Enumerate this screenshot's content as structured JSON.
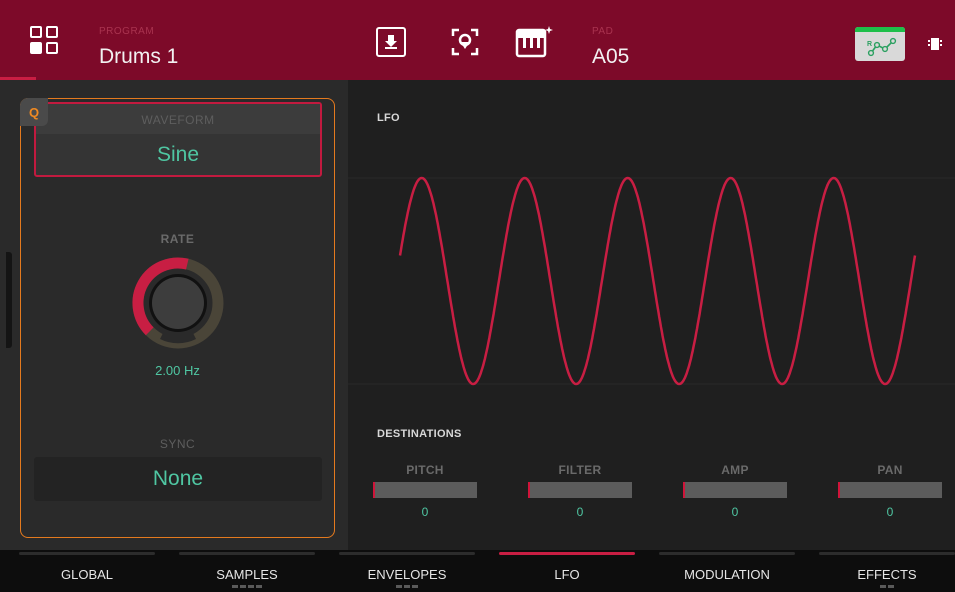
{
  "header": {
    "program_label": "PROGRAM",
    "program_value": "Drums 1",
    "pad_label": "PAD",
    "pad_value": "A05",
    "icons": [
      "grid-menu-icon",
      "download-icon",
      "locate-icon",
      "pad-keyboard-icon",
      "automation-icon",
      "chip-icon"
    ],
    "automation_status_color": "#1fbf4a"
  },
  "left": {
    "q_badge": "Q",
    "waveform": {
      "label": "WAVEFORM",
      "value": "Sine"
    },
    "rate": {
      "label": "RATE",
      "value": "2.00 Hz",
      "knob_level": 0.55
    },
    "sync": {
      "label": "SYNC",
      "value": "None"
    }
  },
  "lfo": {
    "title": "LFO",
    "wave_type": "sine",
    "cycles_shown": 5,
    "wave_color": "#c81e43"
  },
  "destinations": {
    "title": "DESTINATIONS",
    "items": [
      {
        "name": "PITCH",
        "value": "0"
      },
      {
        "name": "FILTER",
        "value": "0"
      },
      {
        "name": "AMP",
        "value": "0"
      },
      {
        "name": "PAN",
        "value": "0"
      }
    ]
  },
  "tabs": [
    {
      "label": "GLOBAL",
      "active": false,
      "pages": 0
    },
    {
      "label": "SAMPLES",
      "active": false,
      "pages": 4
    },
    {
      "label": "ENVELOPES",
      "active": false,
      "pages": 3
    },
    {
      "label": "LFO",
      "active": true,
      "pages": 0
    },
    {
      "label": "MODULATION",
      "active": false,
      "pages": 0
    },
    {
      "label": "EFFECTS",
      "active": false,
      "pages": 2
    }
  ],
  "colors": {
    "header": "#7d0a29",
    "accent_red": "#c81e43",
    "value_green": "#4fc6a2",
    "q_orange": "#e47a1e"
  }
}
